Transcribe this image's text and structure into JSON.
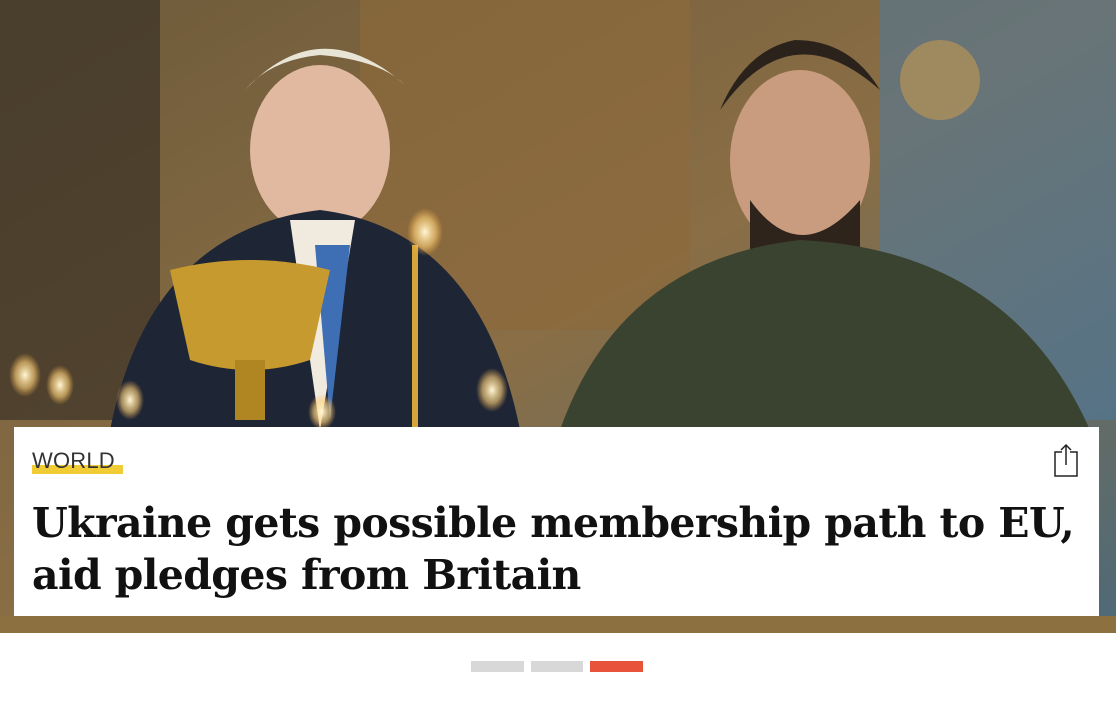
{
  "article": {
    "category": "WORLD",
    "headline": "Ukraine gets possible membership path to EU, aid pledges from Britain"
  },
  "share": {
    "icon": "share-icon"
  },
  "pagination": {
    "count": 3,
    "active_index": 2
  },
  "colors": {
    "category_underline": "#f2cc35",
    "active_dot": "#e8533b",
    "inactive_dot": "#d8d8d8",
    "headline": "#111111"
  }
}
